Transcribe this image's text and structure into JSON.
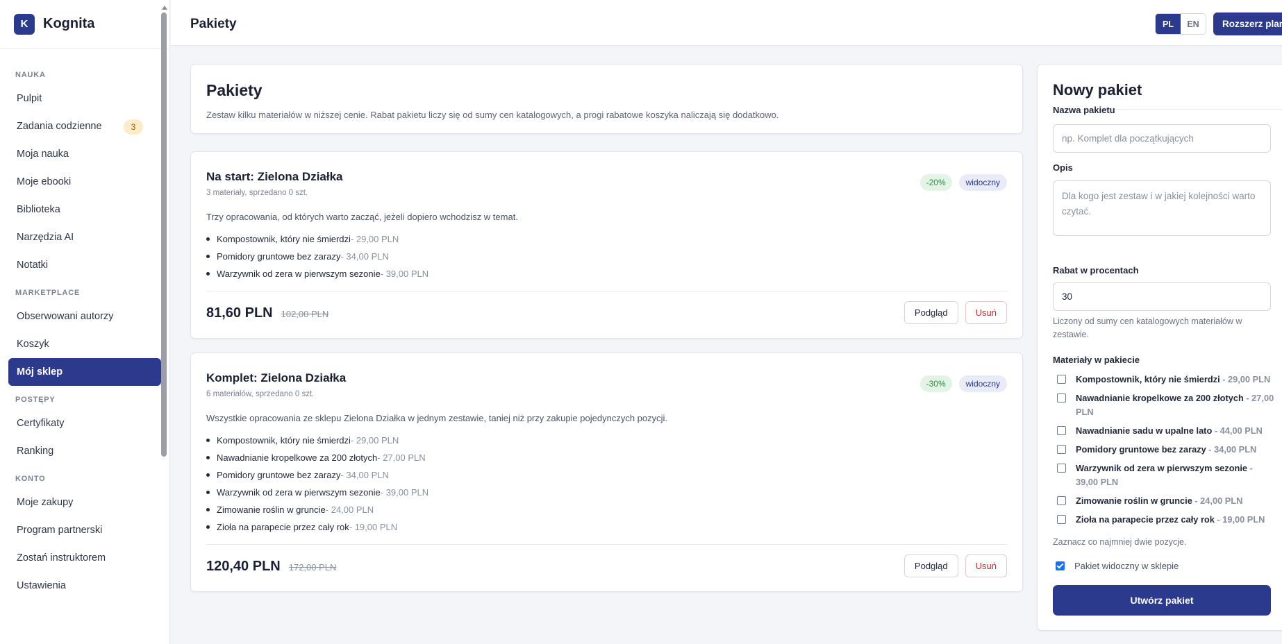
{
  "brand": {
    "logo_letter": "K",
    "name": "Kognita"
  },
  "sidebar": {
    "sections": [
      {
        "label": "NAUKA",
        "items": [
          {
            "label": "Pulpit"
          },
          {
            "label": "Zadania codzienne",
            "badge": "3"
          },
          {
            "label": "Moja nauka"
          },
          {
            "label": "Moje ebooki"
          },
          {
            "label": "Biblioteka"
          },
          {
            "label": "Narzędzia AI"
          },
          {
            "label": "Notatki"
          }
        ]
      },
      {
        "label": "MARKETPLACE",
        "items": [
          {
            "label": "Obserwowani autorzy"
          },
          {
            "label": "Koszyk"
          },
          {
            "label": "Mój sklep",
            "active": true
          }
        ]
      },
      {
        "label": "POSTĘPY",
        "items": [
          {
            "label": "Certyfikaty"
          },
          {
            "label": "Ranking"
          }
        ]
      },
      {
        "label": "KONTO",
        "items": [
          {
            "label": "Moje zakupy"
          },
          {
            "label": "Program partnerski"
          },
          {
            "label": "Zostań instruktorem"
          },
          {
            "label": "Ustawienia"
          }
        ]
      }
    ]
  },
  "header": {
    "title": "Pakiety",
    "lang_pl": "PL",
    "lang_en": "EN",
    "upgrade_label": "Rozszerz plan"
  },
  "intro": {
    "title": "Pakiety",
    "description": "Zestaw kilku materiałów w niższej cenie. Rabat pakietu liczy się od sumy cen katalogowych, a progi rabatowe koszyka naliczają się dodatkowo."
  },
  "bundles": [
    {
      "title": "Na start: Zielona Działka",
      "meta": "3 materiały, sprzedano 0 szt.",
      "discount": "-20%",
      "visibility": "widoczny",
      "description": "Trzy opracowania, od których warto zacząć, jeżeli dopiero wchodzisz w temat.",
      "items": [
        {
          "name": "Kompostownik, który nie śmierdzi",
          "price": " - 29,00 PLN"
        },
        {
          "name": "Pomidory gruntowe bez zarazy",
          "price": " - 34,00 PLN"
        },
        {
          "name": "Warzywnik od zera w pierwszym sezonie",
          "price": " - 39,00 PLN"
        }
      ],
      "price": "81,60 PLN",
      "old_price": "102,00 PLN",
      "preview_label": "Podgląd",
      "delete_label": "Usuń"
    },
    {
      "title": "Komplet: Zielona Działka",
      "meta": "6 materiałów, sprzedano 0 szt.",
      "discount": "-30%",
      "visibility": "widoczny",
      "description": "Wszystkie opracowania ze sklepu Zielona Działka w jednym zestawie, taniej niż przy zakupie pojedynczych pozycji.",
      "items": [
        {
          "name": "Kompostownik, który nie śmierdzi",
          "price": " - 29,00 PLN"
        },
        {
          "name": "Nawadnianie kropelkowe za 200 złotych",
          "price": " - 27,00 PLN"
        },
        {
          "name": "Pomidory gruntowe bez zarazy",
          "price": " - 34,00 PLN"
        },
        {
          "name": "Warzywnik od zera w pierwszym sezonie",
          "price": " - 39,00 PLN"
        },
        {
          "name": "Zimowanie roślin w gruncie",
          "price": " - 24,00 PLN"
        },
        {
          "name": "Zioła na parapecie przez cały rok",
          "price": " - 19,00 PLN"
        }
      ],
      "price": "120,40 PLN",
      "old_price": "172,00 PLN",
      "preview_label": "Podgląd",
      "delete_label": "Usuń"
    }
  ],
  "form": {
    "title": "Nowy pakiet",
    "name_label": "Nazwa pakietu",
    "name_placeholder": "np. Komplet dla początkujących",
    "desc_label": "Opis",
    "desc_placeholder": "Dla kogo jest zestaw i w jakiej kolejności warto czytać.",
    "discount_label": "Rabat w procentach",
    "discount_value": "30",
    "discount_hint": "Liczony od sumy cen katalogowych materiałów w zestawie.",
    "materials_label": "Materiały w pakiecie",
    "materials": [
      {
        "name": "Kompostownik, który nie śmierdzi",
        "price": " - 29,00 PLN"
      },
      {
        "name": "Nawadnianie kropelkowe za 200 złotych",
        "price": " - 27,00 PLN"
      },
      {
        "name": "Nawadnianie sadu w upalne lato",
        "price": " - 44,00 PLN"
      },
      {
        "name": "Pomidory gruntowe bez zarazy",
        "price": " - 34,00 PLN"
      },
      {
        "name": "Warzywnik od zera w pierwszym sezonie",
        "price": " - 39,00 PLN"
      },
      {
        "name": "Zimowanie roślin w gruncie",
        "price": " - 24,00 PLN"
      },
      {
        "name": "Zioła na parapecie przez cały rok",
        "price": " - 19,00 PLN"
      }
    ],
    "materials_hint": "Zaznacz co najmniej dwie pozycje.",
    "visible_label": "Pakiet widoczny w sklepie",
    "visible_checked": true,
    "submit_label": "Utwórz pakiet"
  },
  "colors": {
    "primary": "#2b3a8c",
    "discount_bg": "#e3f4e6",
    "danger": "#c23030"
  }
}
